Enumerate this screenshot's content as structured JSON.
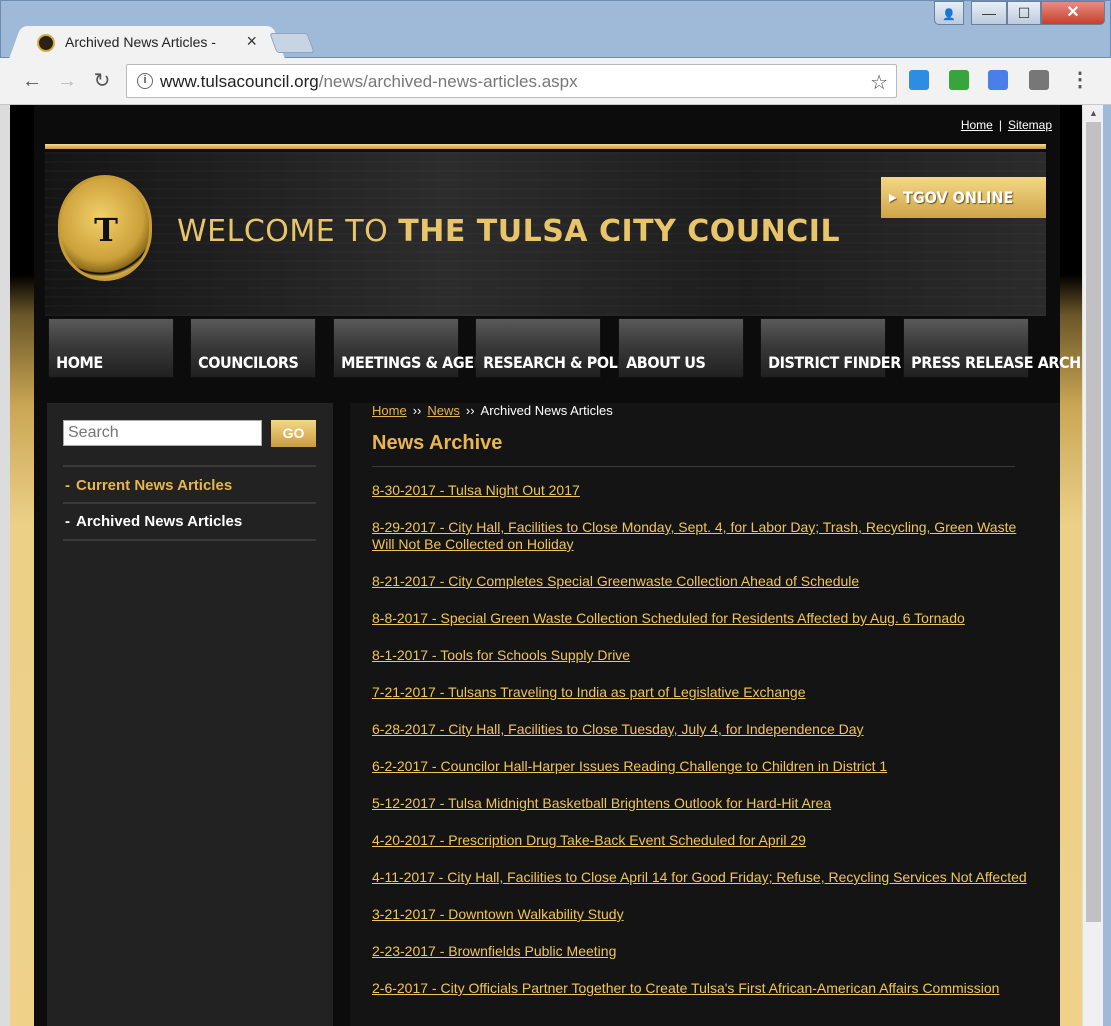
{
  "browser": {
    "tab_title": "Archived News Articles -",
    "tab_close": "×",
    "url_domain": "www.tulsacouncil.org",
    "url_path": "/news/archived-news-articles.aspx",
    "info_glyph": "i",
    "star_glyph": "☆",
    "back_glyph": "←",
    "forward_glyph": "→",
    "reload_glyph": "↻",
    "menu_glyph": "⋮",
    "minimize_glyph": "—",
    "maximize_glyph": "☐",
    "close_glyph": "✕",
    "user_glyph": "👤"
  },
  "site": {
    "util_links": {
      "home": "Home",
      "separator": "|",
      "sitemap": "Sitemap"
    },
    "welcome_prefix": "WELCOME TO ",
    "welcome_strong": "THE TULSA CITY COUNCIL",
    "tgov_label": "TGOV ONLINE",
    "tgov_arrow": "▶",
    "nav": [
      "HOME",
      "COUNCILORS",
      "MEETINGS & AGENDAS",
      "RESEARCH & POLICY",
      "ABOUT US",
      "DISTRICT FINDER",
      "PRESS RELEASE ARCHIVE"
    ]
  },
  "sidebar": {
    "search_placeholder": "Search",
    "go_label": "GO",
    "links": [
      {
        "dash": "-",
        "label": "Current News Articles"
      },
      {
        "dash": "-",
        "label": "Archived News Articles"
      }
    ]
  },
  "content": {
    "breadcrumb": {
      "home": "Home",
      "sep": "››",
      "news": "News",
      "current": "Archived News Articles"
    },
    "heading": "News Archive",
    "articles": [
      "8-30-2017 - Tulsa Night Out 2017",
      "8-29-2017 - City Hall, Facilities to Close Monday, Sept. 4, for Labor Day; Trash, Recycling, Green Waste Will Not Be Collected on Holiday",
      "8-21-2017 - City Completes Special Greenwaste Collection Ahead of Schedule",
      "8-8-2017 - Special Green Waste Collection Scheduled for Residents Affected by Aug. 6 Tornado",
      "8-1-2017 - Tools for Schools Supply Drive",
      "7-21-2017 - Tulsans Traveling to India as part of Legislative Exchange",
      "6-28-2017 - City Hall, Facilities to Close Tuesday, July 4, for Independence Day",
      "6-2-2017 - Councilor Hall-Harper Issues Reading Challenge to Children in District 1",
      "5-12-2017 - Tulsa Midnight Basketball Brightens Outlook for Hard-Hit Area",
      "4-20-2017 - Prescription Drug Take-Back Event Scheduled for April 29",
      "4-11-2017 - City Hall, Facilities to Close April 14 for Good Friday; Refuse, Recycling Services Not Affected",
      "3-21-2017 - Downtown Walkability Study",
      "2-23-2017 - Brownfields Public Meeting",
      "2-6-2017 - City Officials Partner Together to Create Tulsa's First African-American Affairs Commission"
    ]
  }
}
